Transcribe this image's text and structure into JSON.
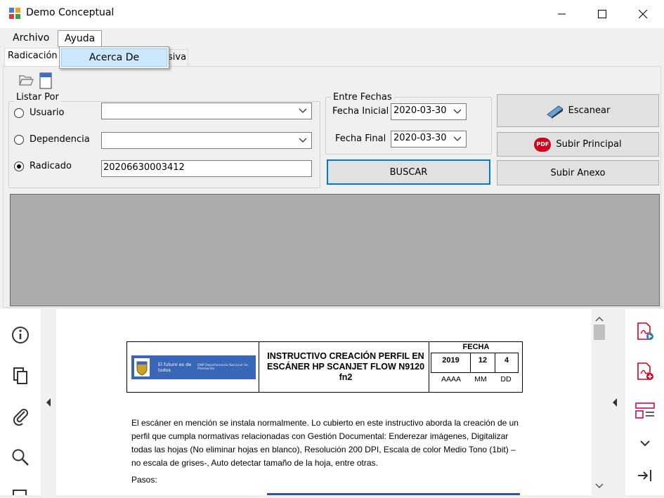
{
  "window": {
    "title": "Demo Conceptual"
  },
  "menu": {
    "items": [
      "Archivo",
      "Ayuda"
    ],
    "dropdown_item": "Acerca De"
  },
  "tabs": {
    "active": "Radicación",
    "second_partial": "siva"
  },
  "listar": {
    "group_label": "Listar Por",
    "usuario": {
      "label": "Usuario",
      "value": ""
    },
    "dependencia": {
      "label": "Dependencia",
      "value": ""
    },
    "radicado": {
      "label": "Radicado",
      "value": "20206630003412"
    }
  },
  "fechas": {
    "group_label": "Entre Fechas",
    "inicial_label": "Fecha Inicial",
    "inicial_value": "2020-03-30",
    "final_label": "Fecha Final",
    "final_value": "2020-03-30"
  },
  "buttons": {
    "buscar": "BUSCAR",
    "escanear": "Escanear",
    "subir_principal": "Subir Principal",
    "subir_anexo": "Subir Anexo",
    "pdf_badge": "PDF"
  },
  "document": {
    "logo_text": "El futuro es de todos",
    "logo_sub": "DNP Departamento Nacional de Planeación",
    "title": "INSTRUCTIVO CREACIÓN PERFIL EN ESCÁNER HP SCANJET FLOW N9120 fn2",
    "fecha_label": "FECHA",
    "year": "2019",
    "month": "12",
    "day": "4",
    "year_label": "AAAA",
    "month_label": "MM",
    "day_label": "DD",
    "paragraph": "El escáner en mención se instala normalmente. Lo cubierto en este instructivo aborda la creación de un perfil que cumpla normativas relacionadas con Gestión Documental: Enderezar imágenes, Digitalizar todas las hojas (No eliminar hojas en blanco), Resolución 200 DPI, Escala de color Medio Tono (1bit) – no escala de grises-, Auto detectar tamaño de la hoja, entre otras.",
    "pasos": "Pasos:"
  },
  "colors": {
    "accent": "#0078d7",
    "highlight": "#cce8ff",
    "pdf_red": "#d0021b",
    "doc_blue": "#2f5597"
  }
}
